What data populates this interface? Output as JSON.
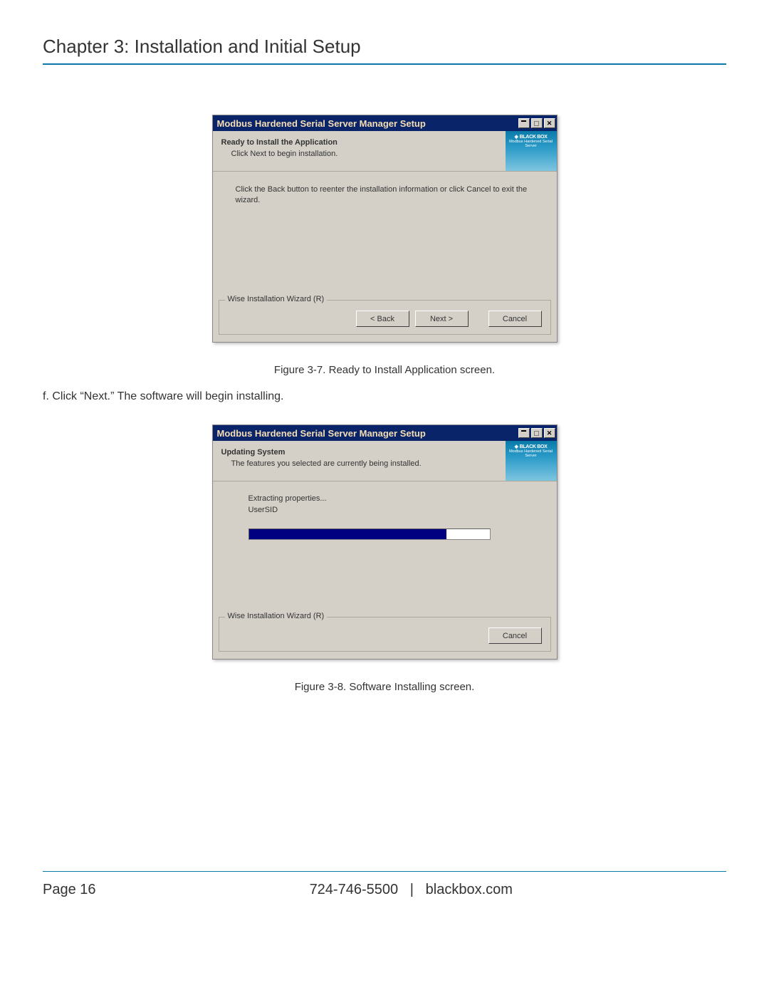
{
  "chapter_heading": "Chapter 3: Installation and Initial Setup",
  "dialog1": {
    "title": "Modbus Hardened Serial Server Manager Setup",
    "header_bold": "Ready to Install the Application",
    "header_sub": "Click Next to begin installation.",
    "logo_brand": "BLACK BOX",
    "logo_sub": "Modbus Hardened Serial Server",
    "content_msg": "Click the Back button to reenter the installation information or click Cancel to exit the wizard.",
    "fieldset_legend": "Wise Installation Wizard (R)",
    "btn_back": "< Back",
    "btn_next": "Next >",
    "btn_cancel": "Cancel"
  },
  "figure1_caption": "Figure 3-7. Ready to Install Application screen.",
  "body_step": "f. Click “Next.” The software will begin installing.",
  "dialog2": {
    "title": "Modbus Hardened Serial Server Manager Setup",
    "header_bold": "Updating System",
    "header_sub": "The features you selected are currently being installed.",
    "logo_brand": "BLACK BOX",
    "logo_sub": "Modbus Hardened Serial Server",
    "progress_label": "Extracting properties...",
    "progress_item": "UserSID",
    "progress_percent": 82,
    "fieldset_legend": "Wise Installation Wizard (R)",
    "btn_cancel": "Cancel"
  },
  "figure2_caption": "Figure 3-8. Software Installing screen.",
  "footer": {
    "page_label": "Page 16",
    "phone": "724-746-5500",
    "sep": "|",
    "site": "blackbox.com"
  }
}
